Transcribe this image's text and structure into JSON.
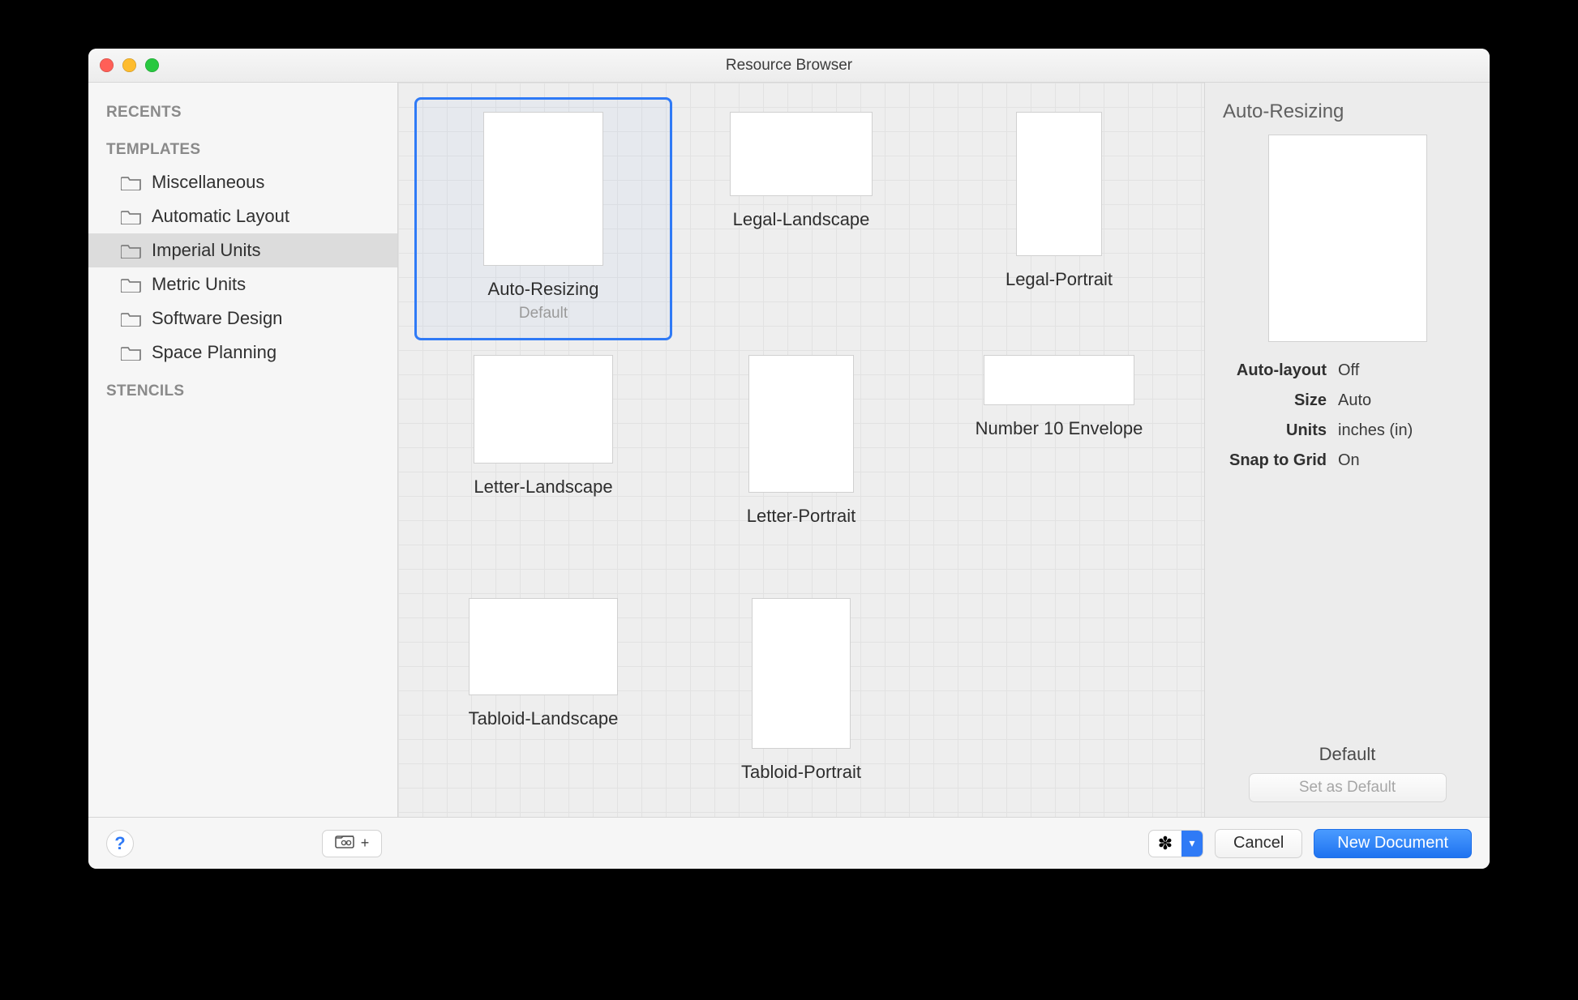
{
  "window": {
    "title": "Resource Browser"
  },
  "sidebar": {
    "sections": {
      "recents_label": "RECENTS",
      "templates_label": "TEMPLATES",
      "stencils_label": "STENCILS"
    },
    "templates": [
      {
        "label": "Miscellaneous"
      },
      {
        "label": "Automatic Layout"
      },
      {
        "label": "Imperial Units"
      },
      {
        "label": "Metric Units"
      },
      {
        "label": "Software Design"
      },
      {
        "label": "Space Planning"
      }
    ],
    "selected_index": 2
  },
  "gallery": {
    "items": [
      {
        "label": "Auto-Resizing",
        "sub": "Default",
        "shape": "th-auto",
        "selected": true
      },
      {
        "label": "Legal-Landscape",
        "shape": "th-legal-l"
      },
      {
        "label": "Legal-Portrait",
        "shape": "th-legal-p"
      },
      {
        "label": "Letter-Landscape",
        "shape": "th-letter-l"
      },
      {
        "label": "Letter-Portrait",
        "shape": "th-letter-p"
      },
      {
        "label": "Number 10 Envelope",
        "shape": "th-env"
      },
      {
        "label": "Tabloid-Landscape",
        "shape": "th-tabl-l"
      },
      {
        "label": "Tabloid-Portrait",
        "shape": "th-tabl-p"
      }
    ]
  },
  "inspector": {
    "title": "Auto-Resizing",
    "props": {
      "auto_layout": {
        "k": "Auto-layout",
        "v": "Off"
      },
      "size": {
        "k": "Size",
        "v": "Auto"
      },
      "units": {
        "k": "Units",
        "v": "inches (in)"
      },
      "snap": {
        "k": "Snap to Grid",
        "v": "On"
      }
    },
    "default_label": "Default",
    "set_default": "Set as Default"
  },
  "footer": {
    "cancel": "Cancel",
    "new_document": "New Document"
  }
}
